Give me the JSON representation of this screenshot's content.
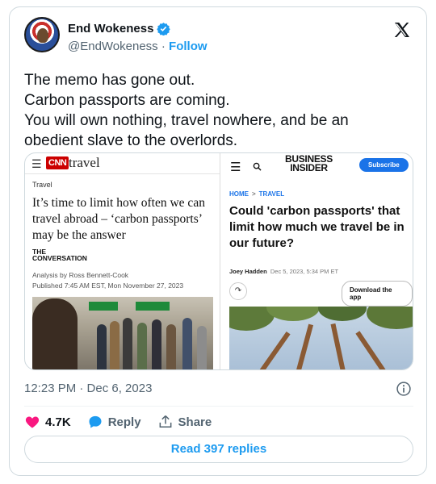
{
  "tweet": {
    "display_name": "End Wokeness",
    "handle": "@EndWokeness",
    "separator": " · ",
    "follow_label": "Follow",
    "lines": [
      "The memo has gone out.",
      "Carbon passports are coming.",
      "You will own nothing, travel nowhere, and be an",
      "obedient slave to the overlords."
    ],
    "timestamp": "12:23 PM · Dec 6, 2023",
    "likes": "4.7K",
    "reply_label": "Reply",
    "share_label": "Share",
    "read_replies": "Read 397 replies",
    "icons": {
      "verified": "verified-badge-icon",
      "x_logo": "x-logo-icon",
      "info": "info-icon",
      "like": "heart-icon",
      "reply": "reply-bubble-icon",
      "share": "share-arrow-icon"
    },
    "colors": {
      "accent": "#1d9bf0",
      "like": "#f91880",
      "text": "#0f1419",
      "muted": "#536471"
    }
  },
  "media": {
    "cnn": {
      "logo": "CNN",
      "section": "travel",
      "kicker": "Travel",
      "headline": "It’s time to limit how often we can travel abroad – ‘carbon passports’ may be the answer",
      "source_top": "THE",
      "source_bottom": "CONVERSATION",
      "byline": "Analysis by Ross Bennett-Cook",
      "published": "Published 7:45 AM EST, Mon November 27, 2023"
    },
    "bi": {
      "logo_top": "BUSINESS",
      "logo_bottom": "INSIDER",
      "subscribe": "Subscribe",
      "crumb_home": "HOME",
      "crumb_sep": ">",
      "crumb_section": "TRAVEL",
      "headline": "Could 'carbon passports' that limit how much we travel be in our future?",
      "author": "Joey Hadden",
      "date": "Dec 5, 2023, 5:34 PM ET",
      "download": "Download the app"
    }
  }
}
